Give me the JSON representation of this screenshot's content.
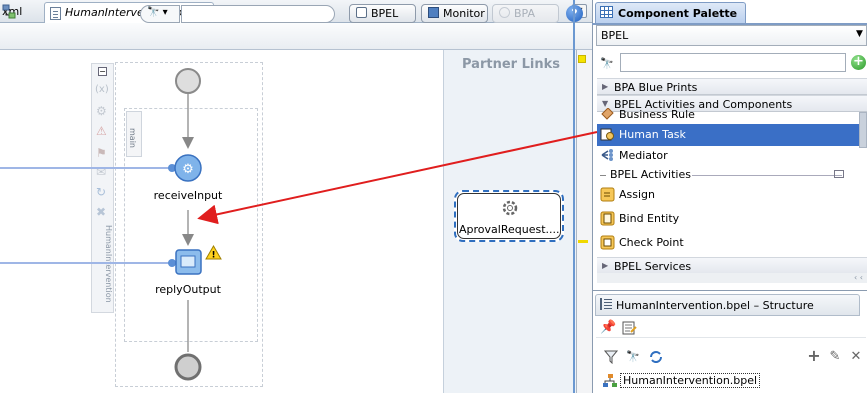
{
  "editor": {
    "tabs": [
      {
        "label": "xml"
      },
      {
        "label": "HumanIntervention.bpel",
        "active": true
      }
    ],
    "toolbar": {
      "search_value": "",
      "bpel_label": "BPEL",
      "monitor_label": "Monitor",
      "bpa_label": "BPA",
      "help_label": "?"
    },
    "canvas": {
      "rail_label": "HumanIntervention",
      "scope_label": "main",
      "activities": [
        {
          "label": "receiveInput"
        },
        {
          "label": "replyOutput",
          "warning": true
        }
      ]
    },
    "partner_links": {
      "title": "Partner Links",
      "nodes": [
        {
          "label": "AprovalRequest...."
        }
      ]
    }
  },
  "palette": {
    "title": "Component Palette",
    "selected": "BPEL",
    "search_value": "",
    "categories": [
      {
        "label": "BPA Blue Prints",
        "expanded": false
      },
      {
        "label": "BPEL Activities and Components",
        "expanded": true
      },
      {
        "label": "BPEL Services",
        "expanded": false
      }
    ],
    "items": [
      {
        "label": "Business Rule"
      },
      {
        "label": "Human Task",
        "selected": true
      },
      {
        "label": "Mediator"
      }
    ],
    "activities_header": "BPEL Activities",
    "activities": [
      {
        "label": "Assign"
      },
      {
        "label": "Bind Entity"
      },
      {
        "label": "Check Point"
      }
    ]
  },
  "structure": {
    "title": "HumanIntervention.bpel – Structure",
    "tree_root": "HumanIntervention.bpel"
  },
  "colors": {
    "selection": "#3a6fc6",
    "annotation_arrow": "#e01e1e",
    "partner_link_border": "#2f6fc0",
    "wire": "#9fb6e6"
  }
}
